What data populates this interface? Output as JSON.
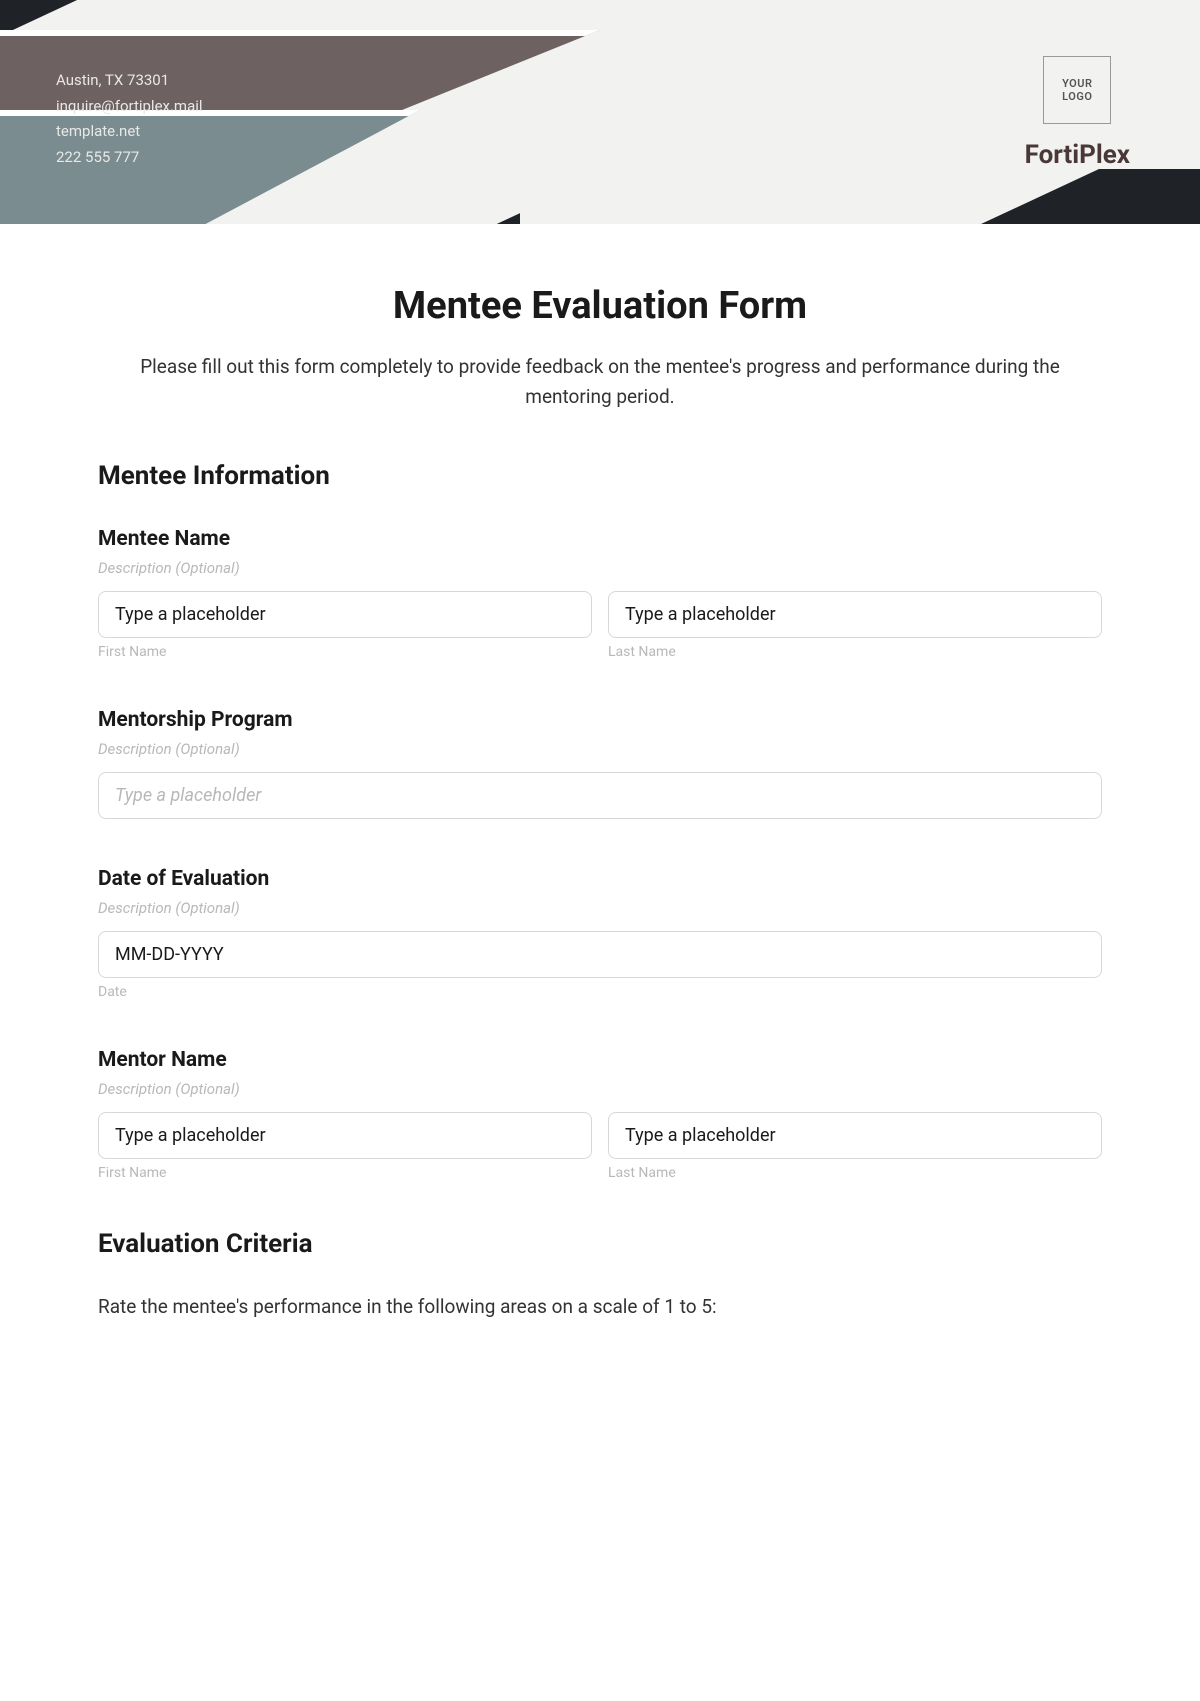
{
  "header": {
    "contact": {
      "line1": "Austin, TX 73301",
      "line2": "inquire@fortiplex.mail",
      "line3": "template.net",
      "line4": "222 555 777"
    },
    "logo_text": "YOUR\nLOGO",
    "company": "FortiPlex"
  },
  "form": {
    "title": "Mentee Evaluation Form",
    "intro": "Please fill out this form completely to provide feedback on the mentee's progress and performance during the mentoring period.",
    "section1_title": "Mentee Information",
    "mentee_name": {
      "label": "Mentee Name",
      "desc": "Description (Optional)",
      "first_value": "Type a placeholder",
      "first_sub": "First Name",
      "last_value": "Type a placeholder",
      "last_sub": "Last Name"
    },
    "program": {
      "label": "Mentorship Program",
      "desc": "Description (Optional)",
      "placeholder": "Type a placeholder"
    },
    "date": {
      "label": "Date of Evaluation",
      "desc": "Description (Optional)",
      "value": "MM-DD-YYYY",
      "sub": "Date"
    },
    "mentor_name": {
      "label": "Mentor Name",
      "desc": "Description (Optional)",
      "first_value": "Type a placeholder",
      "first_sub": "First Name",
      "last_value": "Type a placeholder",
      "last_sub": "Last Name"
    },
    "section2_title": "Evaluation Criteria",
    "criteria_text": "Rate the mentee's performance in the following areas on a scale of 1 to 5:"
  }
}
